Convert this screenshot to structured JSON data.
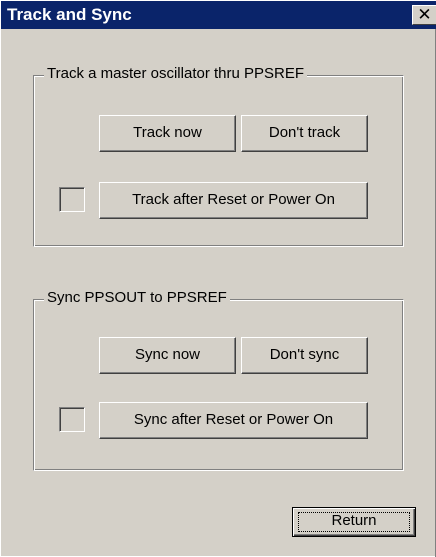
{
  "window": {
    "title": "Track and Sync",
    "close_glyph": "✕"
  },
  "track_group": {
    "label": "Track a master oscillator thru PPSREF",
    "track_now": "Track now",
    "dont_track": "Don't track",
    "track_after_reset": "Track after Reset or Power On",
    "checkbox_checked": false
  },
  "sync_group": {
    "label": "Sync PPSOUT to PPSREF",
    "sync_now": "Sync now",
    "dont_sync": "Don't sync",
    "sync_after_reset": "Sync after Reset or Power On",
    "checkbox_checked": false
  },
  "footer": {
    "return_label": "Return"
  }
}
